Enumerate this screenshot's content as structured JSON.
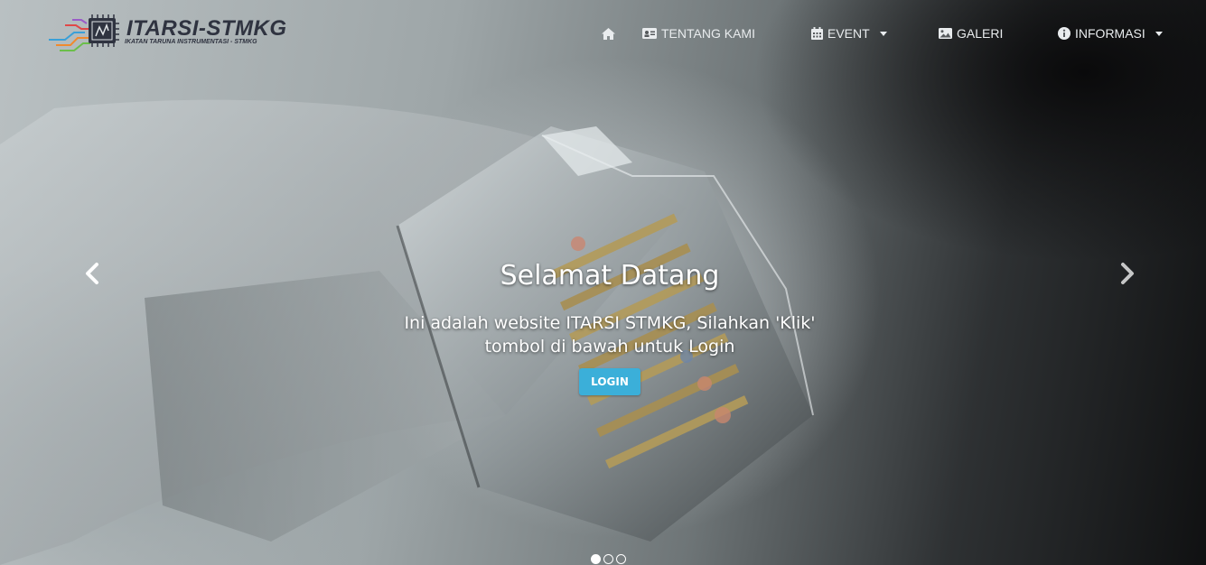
{
  "brand": {
    "title": "ITARSI-STMKG",
    "subtitle": "IKATAN TARUNA INSTRUMENTASI - STMKG",
    "logo_icon": "circuit-chip-icon"
  },
  "nav": {
    "home_icon": "home-icon",
    "items": [
      {
        "label": "TENTANG KAMI",
        "icon": "id-card-icon",
        "dropdown": false
      },
      {
        "label": "EVENT",
        "icon": "calendar-icon",
        "dropdown": true
      },
      {
        "label": "GALERI",
        "icon": "image-icon",
        "dropdown": false
      },
      {
        "label": "INFORMASI",
        "icon": "info-circle-icon",
        "dropdown": true
      }
    ]
  },
  "carousel": {
    "heading": "Selamat Datang",
    "text": "Ini adalah website ITARSI STMKG, Silahkan 'Klik' tombol di bawah untuk Login",
    "button_label": "LOGIN",
    "button_color": "#3bafd9",
    "slide_count": 3,
    "active_slide": 1,
    "prev_icon": "chevron-left-icon",
    "next_icon": "chevron-right-icon",
    "background_subject": "ethernet-cable-connector-photo"
  }
}
